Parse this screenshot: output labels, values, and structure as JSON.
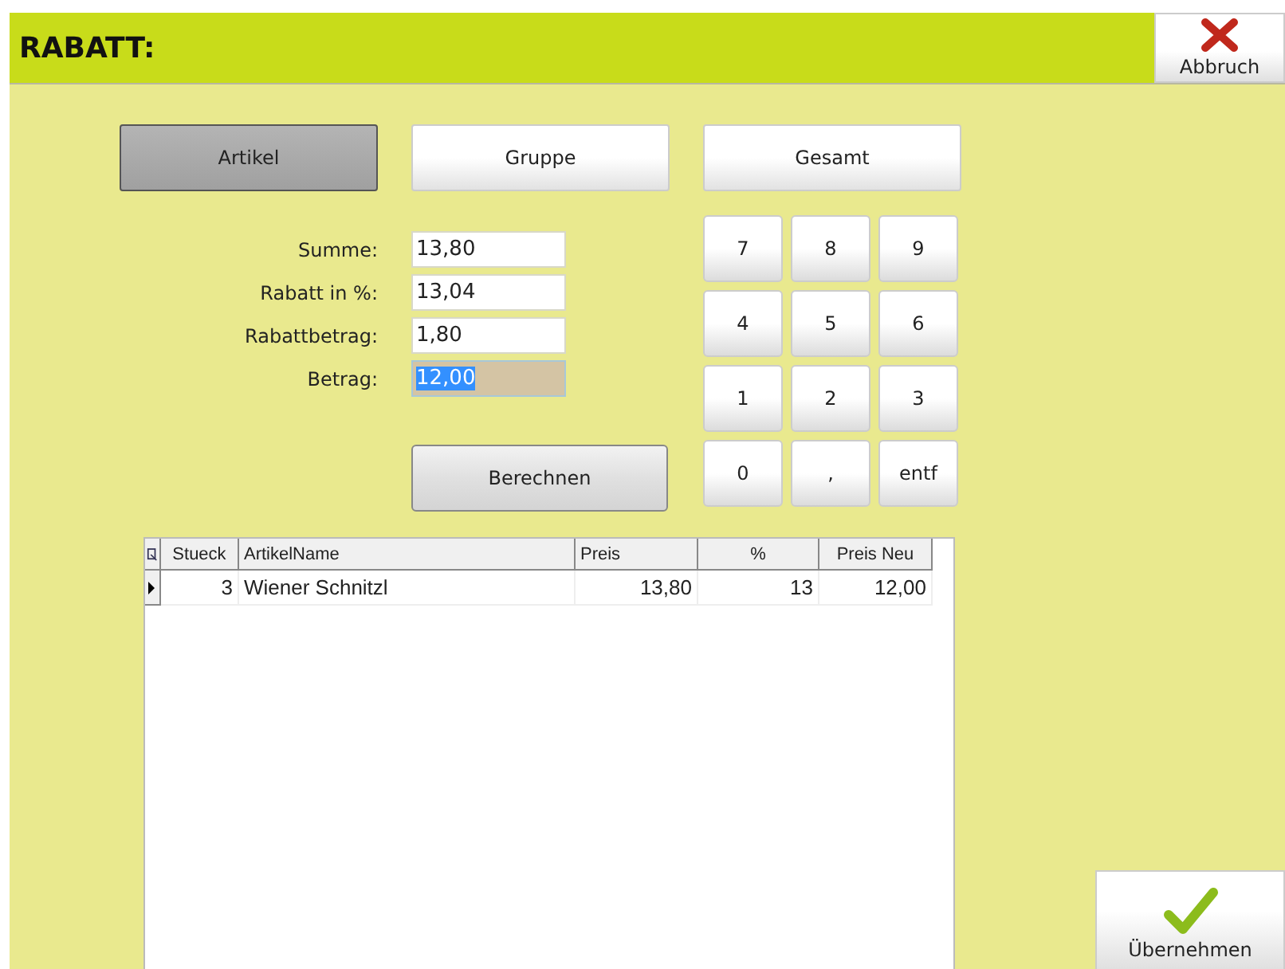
{
  "header": {
    "title": "RABATT:",
    "cancel_button": "Abbruch"
  },
  "tabs": [
    {
      "label": "Artikel",
      "selected": true
    },
    {
      "label": "Gruppe",
      "selected": false
    },
    {
      "label": "Gesamt",
      "selected": false
    }
  ],
  "fields": [
    {
      "label": "Summe:",
      "value": "13,80",
      "focused": false
    },
    {
      "label": "Rabatt in %:",
      "value": "13,04",
      "focused": false
    },
    {
      "label": "Rabattbetrag:",
      "value": "1,80",
      "focused": false
    },
    {
      "label": "Betrag:",
      "value": "12,00",
      "focused": true
    }
  ],
  "calculate_button": "Berechnen",
  "keypad": [
    [
      "7",
      "8",
      "9"
    ],
    [
      "4",
      "5",
      "6"
    ],
    [
      "1",
      "2",
      "3"
    ],
    [
      "0",
      ",",
      "entf"
    ]
  ],
  "table": {
    "columns": [
      "Stueck",
      "ArtikelName",
      "Preis",
      "%",
      "Preis Neu"
    ],
    "rows": [
      {
        "cells": [
          "3",
          "Wiener Schnitzl",
          "13,80",
          "13",
          "12,00"
        ],
        "selected": true
      }
    ]
  },
  "apply_button": "Übernehmen"
}
